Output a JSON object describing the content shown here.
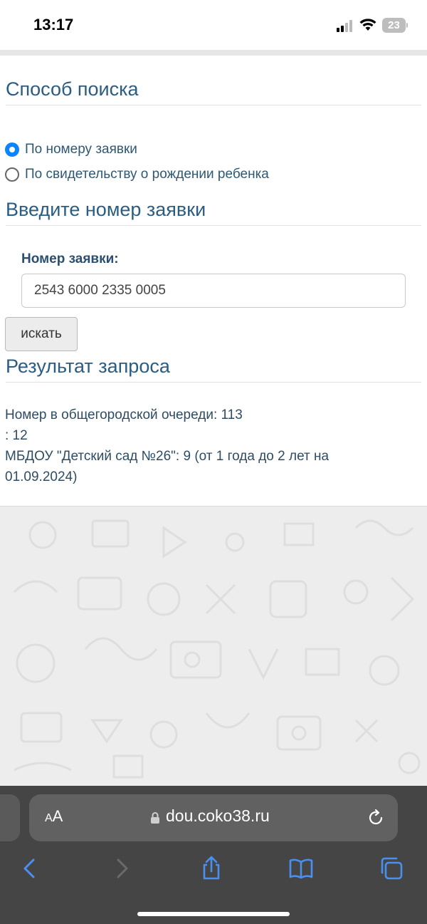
{
  "status_bar": {
    "time": "13:17",
    "battery": "23"
  },
  "search_method": {
    "title": "Способ поиска",
    "options": [
      {
        "label": "По номеру заявки",
        "checked": true
      },
      {
        "label": "По свидетельству о рождении ребенка",
        "checked": false
      }
    ]
  },
  "application_entry": {
    "title": "Введите номер заявки",
    "field_label": "Номер заявки:",
    "field_value": "2543 6000 2335 0005",
    "search_label": "искать"
  },
  "result": {
    "title": "Результат запроса",
    "lines": [
      "Номер в общегородской очереди: 113",
      ": 12",
      "МБДОУ \"Детский сад №26\": 9 (от 1 года до 2 лет на",
      "01.09.2024)"
    ]
  },
  "browser": {
    "aa_label_small": "A",
    "aa_label_large": "A",
    "url": "dou.coko38.ru"
  },
  "colors": {
    "heading": "#2a5d83",
    "accent": "#0a84ff",
    "toolbar": "#454545"
  }
}
